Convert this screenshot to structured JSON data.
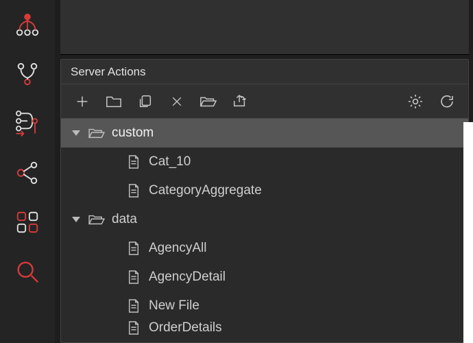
{
  "panel": {
    "title": "Server Actions"
  },
  "toolbar": {
    "add": "Add",
    "folder": "New Folder",
    "copy": "Copy",
    "delete": "Delete",
    "open": "Open",
    "export": "Export",
    "settings": "Settings",
    "refresh": "Refresh"
  },
  "tree": {
    "custom": {
      "label": "custom",
      "children": {
        "cat10": "Cat_10",
        "catagg": "CategoryAggregate"
      }
    },
    "data": {
      "label": "data",
      "children": {
        "agencyAll": "AgencyAll",
        "agencyDetail": "AgencyDetail",
        "newFile": "New File",
        "orderDetails": "OrderDetails"
      }
    }
  },
  "rail": {
    "git": "git-branch",
    "merge": "git-merge",
    "flow": "flow",
    "share": "share",
    "grid": "grid",
    "search": "search"
  }
}
